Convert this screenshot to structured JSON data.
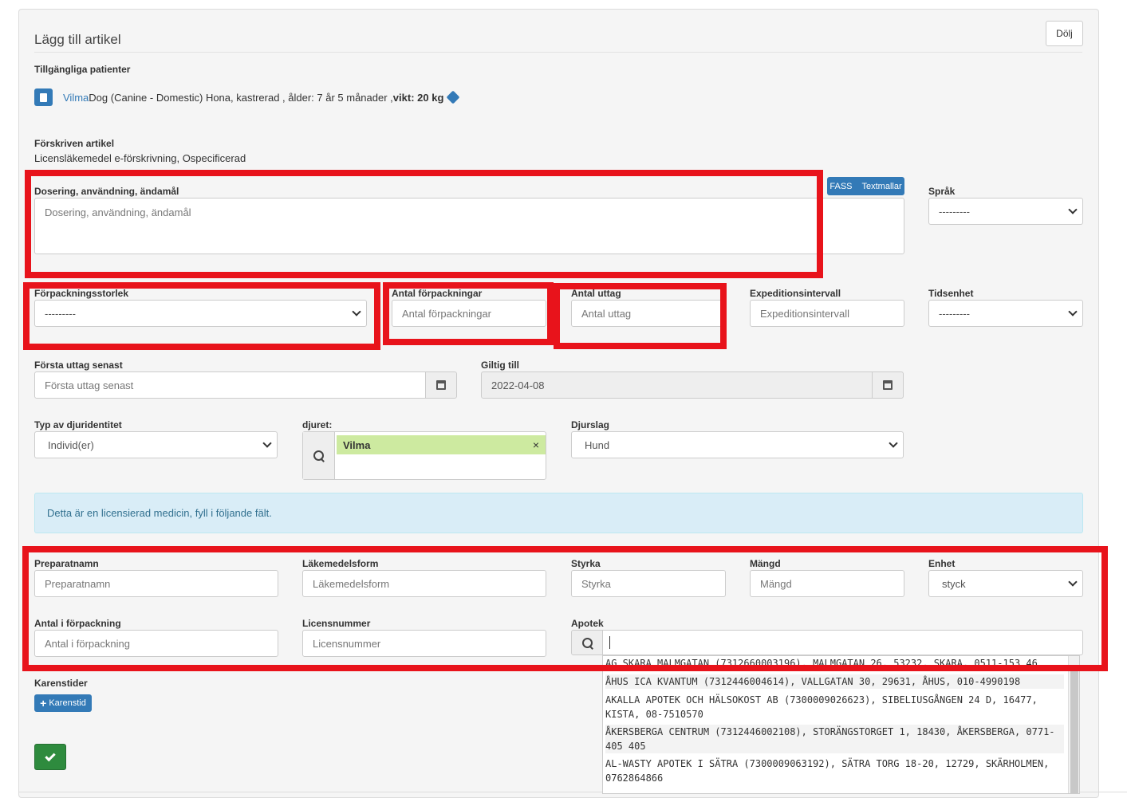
{
  "header": {
    "title": "Lägg till artikel",
    "hide_label": "Dölj"
  },
  "patients": {
    "label": "Tillgängliga patienter",
    "name": "Vilma",
    "details": " Dog (Canine - Domestic) Hona, kastrerad , ålder: 7 år 5 månader ,",
    "weight_label": "vikt: 20 kg"
  },
  "article": {
    "label": "Förskriven artikel",
    "value": "Licensläkemedel e-förskrivning, Ospecificerad"
  },
  "dosage": {
    "label": "Dosering, användning, ändamål",
    "placeholder": "Dosering, användning, ändamål",
    "fass_label": "FASS",
    "templates_label": "Textmallar"
  },
  "language": {
    "label": "Språk",
    "value": "---------"
  },
  "package_size": {
    "label": "Förpackningsstorlek",
    "value": "---------"
  },
  "package_count": {
    "label": "Antal förpackningar",
    "placeholder": "Antal förpackningar"
  },
  "withdrawals": {
    "label": "Antal uttag",
    "placeholder": "Antal uttag"
  },
  "dispense_interval": {
    "label": "Expeditionsintervall",
    "placeholder": "Expeditionsintervall"
  },
  "time_unit": {
    "label": "Tidsenhet",
    "value": "---------"
  },
  "first_withdrawal": {
    "label": "Första uttag senast",
    "placeholder": "Första uttag senast"
  },
  "valid_until": {
    "label": "Giltig till",
    "value": "2022-04-08"
  },
  "animal_id_type": {
    "label": "Typ av djuridentitet",
    "value": "Individ(er)"
  },
  "animal": {
    "label": "djuret:",
    "tag": "Vilma",
    "remove": "×"
  },
  "species": {
    "label": "Djurslag",
    "value": "Hund"
  },
  "alert": {
    "text": "Detta är en licensierad medicin, fyll i följande fält."
  },
  "product_name": {
    "label": "Preparatnamn",
    "placeholder": "Preparatnamn"
  },
  "dosage_form": {
    "label": "Läkemedelsform",
    "placeholder": "Läkemedelsform"
  },
  "strength": {
    "label": "Styrka",
    "placeholder": "Styrka"
  },
  "amount": {
    "label": "Mängd",
    "placeholder": "Mängd"
  },
  "unit": {
    "label": "Enhet",
    "value": "styck"
  },
  "per_package": {
    "label": "Antal i förpackning",
    "placeholder": "Antal i förpackning"
  },
  "license_number": {
    "label": "Licensnummer",
    "placeholder": "Licensnummer"
  },
  "pharmacy": {
    "label": "Apotek",
    "items": [
      "AG SKARA MALMGATAN (7312660003196), MALMGATAN 26, 53232, SKARA, 0511-153 46",
      "ÅHUS ICA KVANTUM (7312446004614), VALLGATAN 30, 29631, ÅHUS, 010-4990198",
      "AKALLA APOTEK OCH HÄLSOKOST AB (7300009026623), SIBELIUSGÅNGEN 24 D, 16477, KISTA, 08-7510570",
      "ÅKERSBERGA CENTRUM (7312446002108), STORÄNGSTORGET 1, 18430, ÅKERSBERGA, 0771-405 405",
      "AL-WASTY APOTEK I SÄTRA (7300009063192), SÄTRA TORG 18-20, 12729, SKÄRHOLMEN, 0762864866"
    ]
  },
  "withdrawal_periods": {
    "label": "Karenstider",
    "add_label": "Karenstid"
  },
  "colors": {
    "primary": "#337ab7",
    "success": "#2e8b3e",
    "highlight": "#e8131b",
    "info_bg": "#d9edf7"
  }
}
